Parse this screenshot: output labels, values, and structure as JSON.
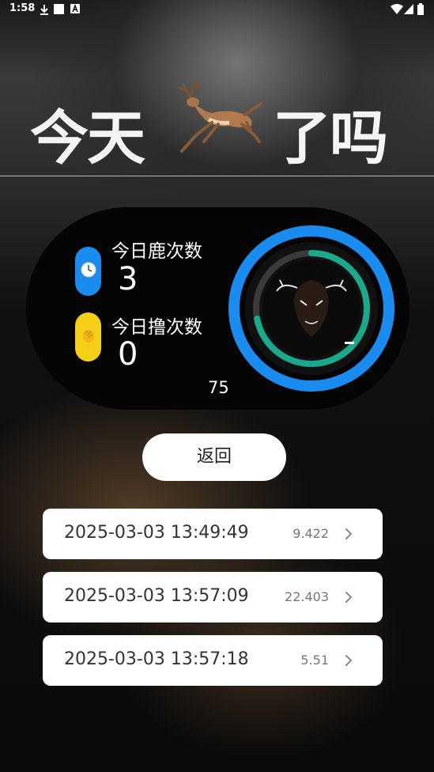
{
  "status_bar": {
    "time": "1:58"
  },
  "header": {
    "title_part1": "今天",
    "title_part2": "了吗"
  },
  "stats": {
    "deer_label": "今日鹿次数",
    "deer_count": "3",
    "clap_label": "今日撸次数",
    "clap_count": "0",
    "extra_value": "75",
    "ring_progress": 0.72
  },
  "back_button": {
    "label": "返回"
  },
  "records": [
    {
      "time": "2025-03-03 13:49:49",
      "value": "9.422"
    },
    {
      "time": "2025-03-03 13:57:09",
      "value": "22.403"
    },
    {
      "time": "2025-03-03 13:57:18",
      "value": "5.51"
    }
  ],
  "colors": {
    "accent_blue": "#1a8cf0",
    "accent_yellow": "#f5cf16",
    "ring_green": "#1aa98c"
  },
  "icons": [
    "download-icon",
    "square-icon",
    "a-icon",
    "wifi-icon",
    "signal-icon",
    "battery-icon",
    "deer-icon",
    "clock-icon",
    "clap-icon",
    "deer-head-icon",
    "chevron-right-icon"
  ]
}
